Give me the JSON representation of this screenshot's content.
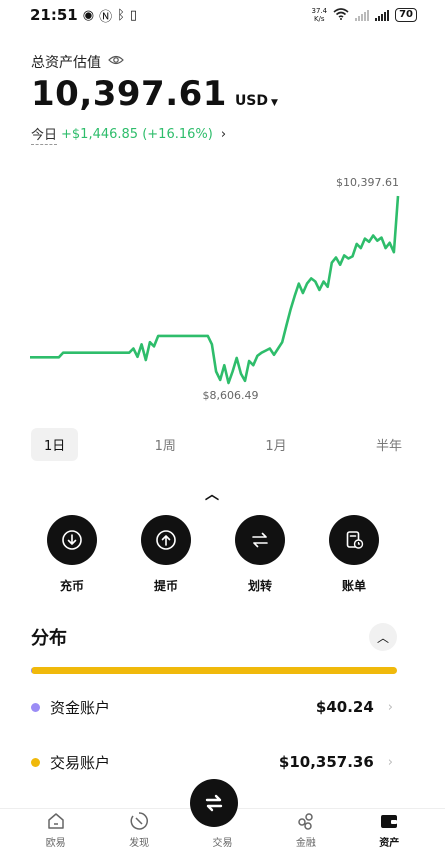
{
  "status_bar": {
    "time": "21:51",
    "left_icons": [
      "eye-icon",
      "nfc-icon",
      "bluetooth-icon",
      "vibrate-icon"
    ],
    "net_speed_value": "37.4",
    "net_speed_unit": "K/s",
    "battery": "70"
  },
  "header": {
    "title": "总资产估值",
    "balance": "10,397.61",
    "currency": "USD",
    "pnl_label": "今日",
    "pnl_value": "+$1,446.85 (+16.16%)"
  },
  "chart_data": {
    "type": "line",
    "x": [
      0,
      1,
      2,
      3,
      4,
      5,
      6,
      7,
      8,
      9,
      10,
      11,
      12,
      13,
      14,
      15,
      16,
      17,
      18,
      19,
      20,
      21,
      22,
      23,
      24,
      25,
      26,
      27,
      28,
      29,
      30,
      31,
      32,
      33,
      34,
      35,
      36,
      37,
      38,
      39,
      40,
      41,
      42,
      43,
      44,
      45,
      46,
      47,
      48,
      49,
      50,
      51,
      52,
      53,
      54,
      55,
      56,
      57,
      58,
      59,
      60,
      61,
      62,
      63,
      64,
      65,
      66,
      67,
      68,
      69,
      70,
      71,
      72,
      73,
      74,
      75,
      76,
      77,
      78,
      79,
      80,
      81,
      82,
      83,
      84,
      85,
      86,
      87,
      88,
      89
    ],
    "series": [
      {
        "values": [
          8856,
          8856,
          8856,
          8856,
          8856,
          8856,
          8856,
          8856,
          8900,
          8900,
          8900,
          8900,
          8900,
          8900,
          8900,
          8900,
          8900,
          8900,
          8900,
          8900,
          8900,
          8900,
          8900,
          8900,
          8900,
          8940,
          8860,
          8980,
          8830,
          9000,
          8960,
          9060,
          9060,
          9060,
          9060,
          9060,
          9060,
          9060,
          9060,
          9060,
          9060,
          9060,
          9060,
          9060,
          8980,
          8720,
          8640,
          8780,
          8610,
          8720,
          8850,
          8700,
          8630,
          8820,
          8780,
          8870,
          8900,
          8920,
          8940,
          8880,
          8940,
          9000,
          9160,
          9310,
          9440,
          9560,
          9470,
          9560,
          9610,
          9580,
          9500,
          9580,
          9530,
          9760,
          9810,
          9740,
          9830,
          9800,
          9820,
          9940,
          9900,
          9990,
          9960,
          10020,
          9970,
          10000,
          9900,
          9950,
          9860,
          10397.61
        ]
      }
    ],
    "annotations": [
      {
        "label": "$10,397.61",
        "type": "max"
      },
      {
        "label": "$8,606.49",
        "type": "min"
      }
    ],
    "line_color": "#2ebd6b",
    "grid": false
  },
  "range_tabs": [
    "1日",
    "1周",
    "1月",
    "半年"
  ],
  "actions": [
    {
      "label": "充币",
      "icon": "deposit-icon"
    },
    {
      "label": "提币",
      "icon": "withdraw-icon"
    },
    {
      "label": "划转",
      "icon": "transfer-icon"
    },
    {
      "label": "账单",
      "icon": "bill-icon"
    }
  ],
  "distribution": {
    "title": "分布",
    "funding_fraction": 0.0039,
    "accounts": [
      {
        "name": "资金账户",
        "value": "$40.24",
        "color": "#9b8cf5"
      },
      {
        "name": "交易账户",
        "value": "$10,357.36",
        "color": "#f0b90b"
      }
    ]
  },
  "bottom_nav": [
    {
      "label": "欧易",
      "icon": "home-icon"
    },
    {
      "label": "发现",
      "icon": "discover-icon"
    },
    {
      "label": "交易",
      "icon": "trade-icon"
    },
    {
      "label": "金融",
      "icon": "finance-icon"
    },
    {
      "label": "资产",
      "icon": "wallet-icon"
    }
  ]
}
